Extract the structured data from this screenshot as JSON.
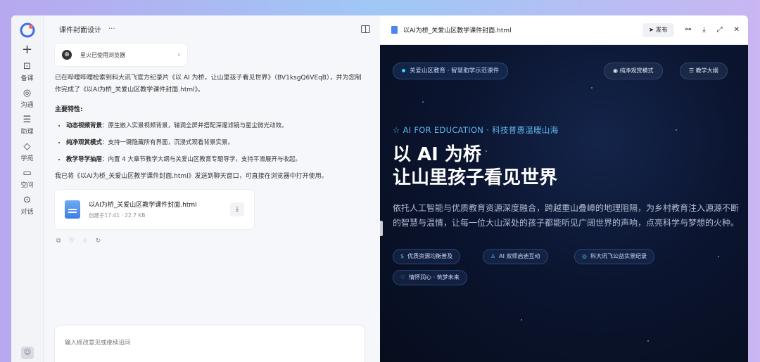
{
  "rail": {
    "plus": "+",
    "items": [
      {
        "icon": "calendar-icon",
        "glyph": "⊡",
        "label": "备课"
      },
      {
        "icon": "chat-bubbles-icon",
        "glyph": "◎",
        "label": "沟通"
      },
      {
        "icon": "menu-lines-icon",
        "glyph": "☰",
        "label": "助理"
      },
      {
        "icon": "diamond-icon",
        "glyph": "◇",
        "label": "学苑"
      },
      {
        "icon": "folder-icon",
        "glyph": "▭",
        "label": "空间"
      },
      {
        "icon": "dialog-icon",
        "glyph": "⊙",
        "label": "对话"
      }
    ]
  },
  "chat": {
    "title": "课件封面设计",
    "dots": "···",
    "tool_card": "星火已使用浏览器",
    "intro": "已在哔哩哔哩检索到科大讯飞官方纪录片《以 AI 为桥，让山里孩子看见世界》（BV1ksgQ6VEqB），并为您制作完成了《以AI为桥_关爱山区教学课件封面.html》。",
    "features_title": "主要特性:",
    "features": [
      {
        "name": "动态视频背景",
        "text": "：原生嵌入实景视频背景，辅调全屏并搭配深邃滤镜与星尘微光动效。"
      },
      {
        "name": "纯净观赏模式",
        "text": "：支持一键隐藏所有界面，沉浸式观看背景实景。"
      },
      {
        "name": "教学导学抽屉",
        "text": "：内置 4 大章节教学大纲与关爱山区教育专题导学，支持平滑展开与收起。"
      }
    ],
    "closing": "我已将《以AI为桥_关爱山区教学课件封面.html》发送到聊天窗口，可直接在浏览器中打开使用。",
    "file": {
      "name": "以AI为桥_关爱山区教学课件封面.html",
      "meta": "创建于17:41 · 22.7 KB"
    },
    "input_placeholder": "输入修改意见或继续追问"
  },
  "preview": {
    "filename": "以AI为桥_关爱山区教学课件封面.html",
    "publish": "发布",
    "badge": "关爱山区教育 · 智慧助学示范课件",
    "pure_mode": "纯净观赏模式",
    "outline": "教学大纲",
    "eyebrow": "☆ AI FOR EDUCATION · 科技普惠温暖山海",
    "headline_1": "以 AI 为桥",
    "headline_2": "让山里孩子看见世界",
    "description": "依托人工智能与优质教育资源深度融合，跨越重山叠嶂的地理阻隔，为乡村教育注入源源不断的智慧与温情，让每一位大山深处的孩子都能听见广阔世界的声响，点亮科学与梦想的火种。",
    "tags": [
      "优质资源均衡普及",
      "AI 双师启迪互动",
      "科大讯飞公益实景纪录",
      "情怀润心 · 筑梦未来"
    ]
  },
  "colors": {
    "stage_bg": "#0a1326",
    "accent": "#5fb7f0"
  }
}
